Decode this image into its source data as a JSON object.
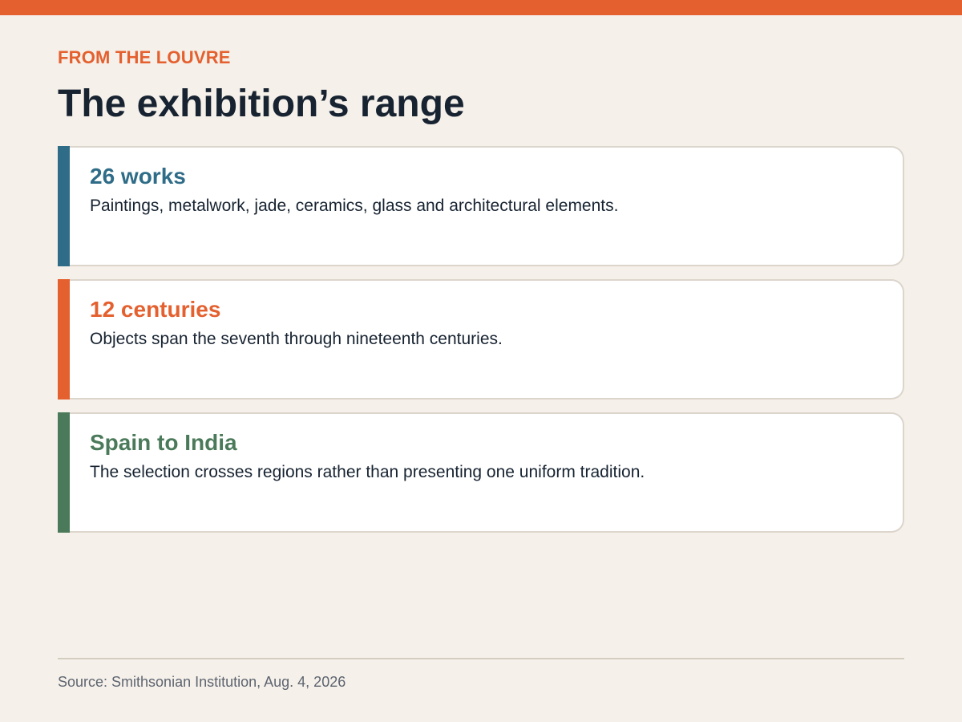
{
  "header": {
    "kicker": "FROM THE LOUVRE",
    "title": "The exhibition’s range"
  },
  "cards": [
    {
      "stat": "26 works",
      "description": "Paintings, metalwork, jade, ceramics, glass and architectural elements.",
      "color": "#2f6c88"
    },
    {
      "stat": "12 centuries",
      "description": "Objects span the seventh through nineteenth centuries.",
      "color": "#e4602f"
    },
    {
      "stat": "Spain to India",
      "description": "The selection crosses regions rather than presenting one uniform tradition.",
      "color": "#4b7a5a"
    }
  ],
  "footer": {
    "source": "Source: Smithsonian Institution, Aug. 4, 2026"
  },
  "colors": {
    "accent": "#e4602f",
    "background": "#f6f0ea",
    "title": "#172331"
  }
}
